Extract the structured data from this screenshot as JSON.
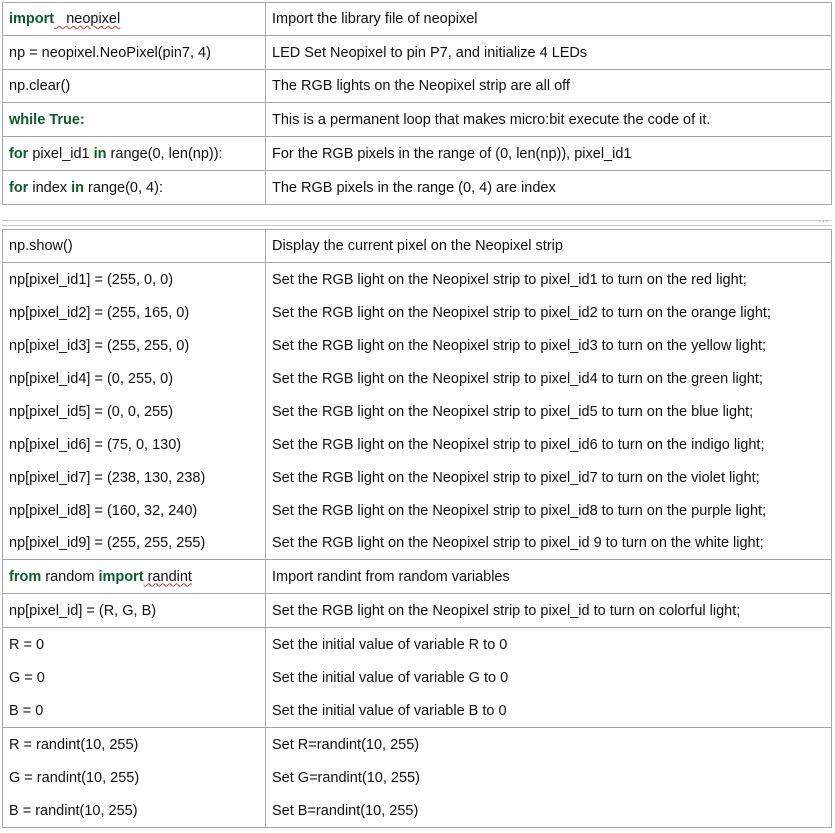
{
  "table_top": {
    "rows": [
      {
        "code": [
          "import",
          "   neopixel"
        ],
        "desc": "Import the library file of neopixel"
      },
      {
        "code": "np = neopixel.NeoPixel(pin7, 4)",
        "desc": "LED Set Neopixel to pin P7, and initialize 4 LEDs"
      },
      {
        "code": "np.clear()",
        "desc": "The RGB lights on the Neopixel strip are all off"
      },
      {
        "code": "while True:",
        "desc": "This is a permanent loop that makes micro:bit execute the code of it."
      },
      {
        "code": [
          "for",
          " pixel_id1 ",
          "in",
          " range(0, len(np)):"
        ],
        "desc": "For the RGB pixels in the range of (0, len(np)), pixel_id1"
      },
      {
        "code": [
          "for",
          " index ",
          "in",
          " range(0, 4):"
        ],
        "desc": "The RGB pixels in the range (0, 4) are index"
      }
    ]
  },
  "separator_dots": "...",
  "table_bottom": {
    "rows": [
      {
        "code": "np.show()",
        "desc": "Display the current pixel on the Neopixel strip"
      },
      {
        "code": "np[pixel_id1] = (255, 0, 0)",
        "desc": "Set the RGB light on the Neopixel strip to pixel_id1 to turn on the red light;"
      },
      {
        "code": "np[pixel_id2] = (255, 165, 0)",
        "desc": "Set the RGB light on the Neopixel strip to pixel_id2 to turn on the orange light;"
      },
      {
        "code": "np[pixel_id3] = (255, 255, 0)",
        "desc": "Set the RGB light on the Neopixel strip to pixel_id3 to turn on the yellow light;"
      },
      {
        "code": "np[pixel_id4] = (0, 255, 0)",
        "desc": "Set the RGB light on the Neopixel strip to pixel_id4 to turn on the green light;"
      },
      {
        "code": "np[pixel_id5] = (0, 0, 255)",
        "desc": "Set the RGB light on the Neopixel strip to pixel_id5 to turn on the blue light;"
      },
      {
        "code": "np[pixel_id6] = (75, 0, 130)",
        "desc": "Set the RGB light on the Neopixel strip to pixel_id6 to turn on the indigo light;"
      },
      {
        "code": "np[pixel_id7] = (238, 130, 238)",
        "desc": "Set the RGB light on the Neopixel strip to pixel_id7 to turn on the violet light;"
      },
      {
        "code": "np[pixel_id8] = (160, 32, 240)",
        "desc": "Set the RGB light on the Neopixel strip to pixel_id8 to turn on the purple light;"
      },
      {
        "code": "np[pixel_id9] = (255, 255, 255)",
        "desc": "Set the RGB light on the Neopixel strip to pixel_id 9 to turn on the white light;"
      },
      {
        "code": [
          "from",
          " random ",
          "import",
          " randint"
        ],
        "desc": "Import randint from random variables"
      },
      {
        "code": "np[pixel_id] = (R, G, B)",
        "desc": "Set the RGB light on the Neopixel strip to pixel_id to turn on colorful light;"
      },
      {
        "code": "R = 0",
        "desc": "Set the initial value of variable R to 0"
      },
      {
        "code": "G = 0",
        "desc": "Set the initial value of variable G to 0"
      },
      {
        "code": "B = 0",
        "desc": "Set the initial value of variable B to 0"
      },
      {
        "code": "R = randint(10, 255)",
        "desc": "Set R=randint(10, 255)"
      },
      {
        "code": "G = randint(10, 255)",
        "desc": "Set G=randint(10, 255)"
      },
      {
        "code": "B = randint(10, 255)",
        "desc": "Set B=randint(10, 255)"
      }
    ]
  },
  "colors": {
    "keyword": "#0b5b2b",
    "border": "#a6a6a6",
    "spellcheck": "#d13b3b"
  }
}
